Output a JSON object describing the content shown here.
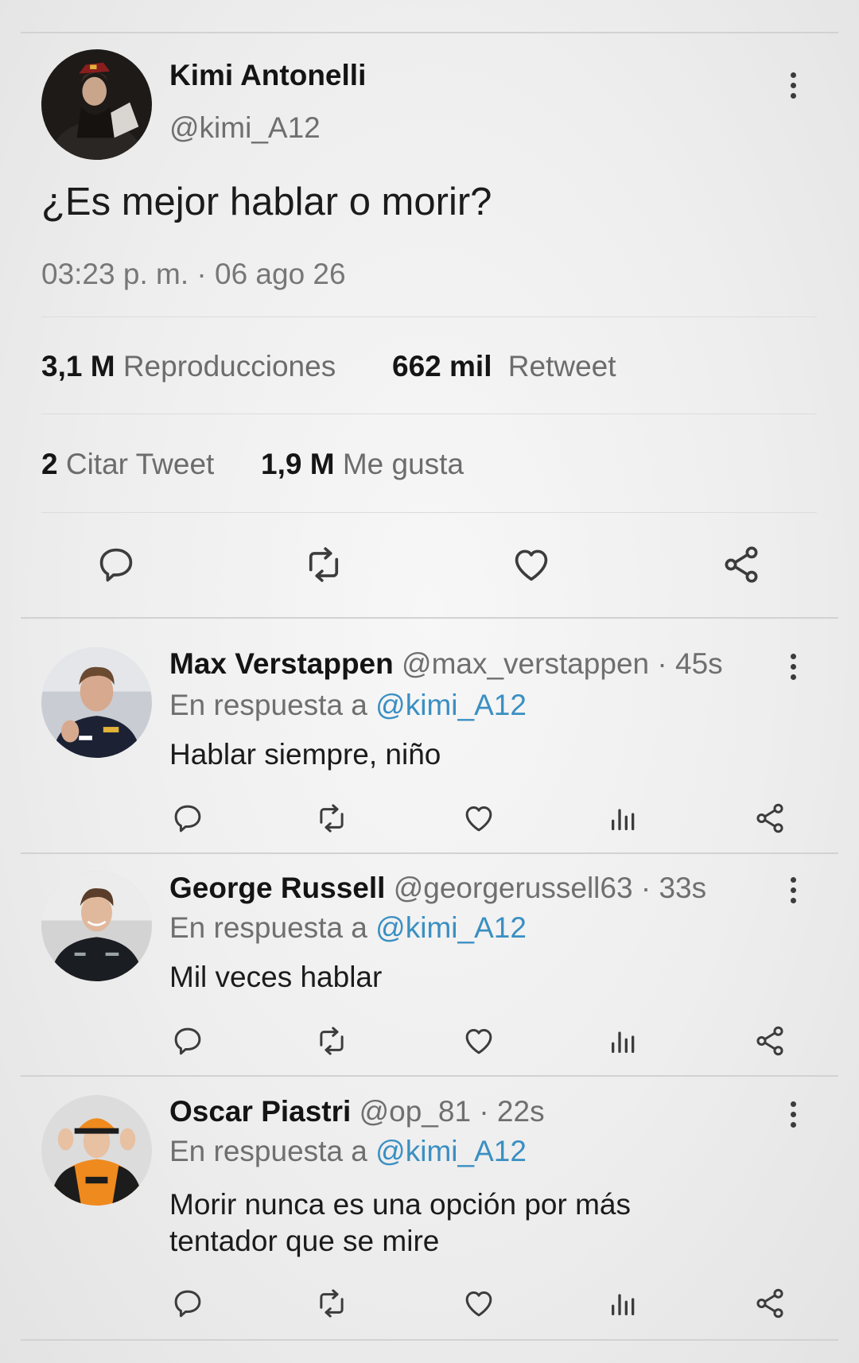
{
  "main_tweet": {
    "author_name": "Kimi Antonelli",
    "handle": "@kimi_A12",
    "text": "¿Es mejor hablar o morir?",
    "timestamp": "03:23 p. m. · 06 ago 26",
    "views_count": "3,1 M",
    "views_label": "Reproducciones",
    "retweets_count": "662 mil",
    "retweets_label": "Retweet",
    "quotes_count": "2",
    "quotes_label": "Citar Tweet",
    "likes_count": "1,9 M",
    "likes_label": "Me gusta"
  },
  "replies": [
    {
      "author_name": "Max Verstappen",
      "handle_time": "@max_verstappen · 45s",
      "reply_prefix": "En respuesta a",
      "reply_to": "@kimi_A12",
      "text": "Hablar siempre, niño"
    },
    {
      "author_name": "George Russell",
      "handle_time": "@georgerussell63 · 33s",
      "reply_prefix": "En respuesta a",
      "reply_to": "@kimi_A12",
      "text": "Mil veces hablar"
    },
    {
      "author_name": "Oscar Piastri",
      "handle_time": "@op_81 · 22s",
      "reply_prefix": "En respuesta a",
      "reply_to": "@kimi_A12",
      "text_line1": "Morir nunca es una opción por más",
      "text_line2": "tentador que se mire"
    }
  ],
  "icons": {
    "reply": "comment-bubble-icon",
    "retweet": "retweet-arrows-icon",
    "like": "heart-icon",
    "views": "bar-chart-icon",
    "share": "share-nodes-icon",
    "more": "vertical-dots-icon"
  },
  "colors": {
    "link": "#3a8fc2",
    "muted_text": "#6f6f6f",
    "icon": "#3c3c3c"
  }
}
